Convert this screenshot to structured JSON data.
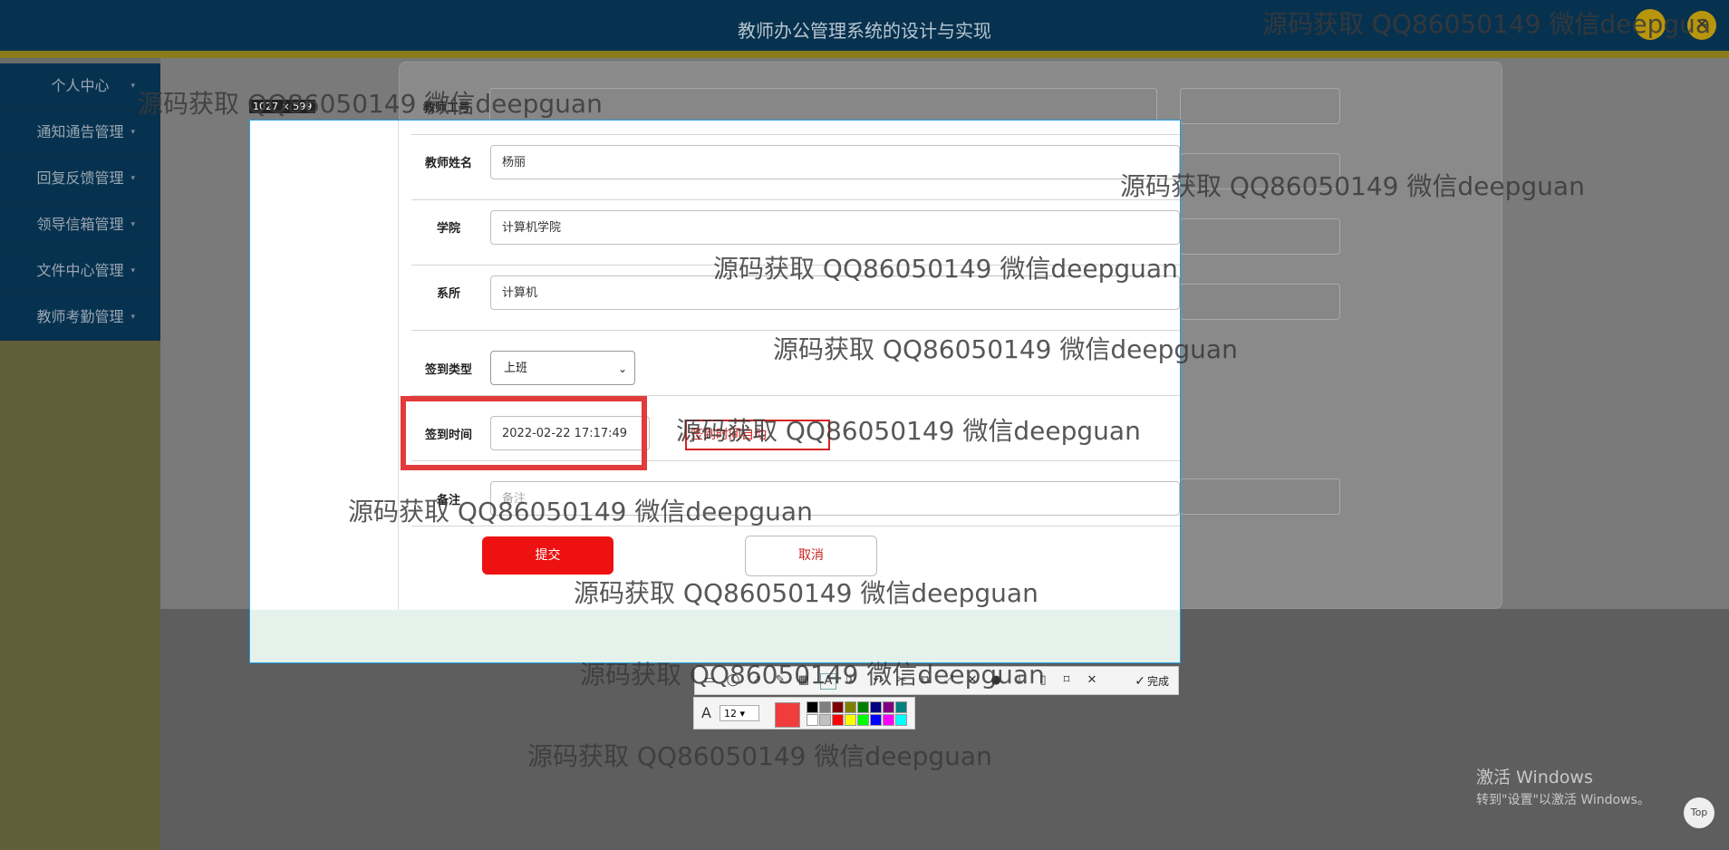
{
  "header": {
    "title": "教师办公管理系统的设计与实现",
    "exit_icon": "close-icon"
  },
  "sidebar": {
    "items": [
      {
        "label": "个人中心"
      },
      {
        "label": "通知通告管理"
      },
      {
        "label": "回复反馈管理"
      },
      {
        "label": "领导信箱管理"
      },
      {
        "label": "文件中心管理"
      },
      {
        "label": "教师考勤管理"
      }
    ]
  },
  "form": {
    "teacher_id_label": "教师工号",
    "teacher_name_label": "教师姓名",
    "teacher_name_value": "杨丽",
    "college_label": "学院",
    "college_value": "计算机学院",
    "department_label": "系所",
    "department_value": "计算机",
    "checkin_type_label": "签到类型",
    "checkin_type_value": "上班",
    "checkin_time_label": "签到时间",
    "checkin_time_value": "2022-02-22 17:17:49",
    "remark_label": "备注",
    "remark_placeholder": "备注",
    "submit_label": "提交",
    "cancel_label": "取消"
  },
  "screenshot_tool": {
    "size_label": "1027 × 599",
    "annotation_text": "签到时间自动",
    "done_label": "完成",
    "font_size": "12",
    "current_color": "#f03c3c",
    "palette": [
      "#000000",
      "#808080",
      "#800000",
      "#808000",
      "#008000",
      "#000080",
      "#800080",
      "#008080",
      "#ffffff",
      "#c0c0c0",
      "#ff0000",
      "#ffff00",
      "#00ff00",
      "#0000ff",
      "#ff00ff",
      "#00ffff"
    ]
  },
  "watermark": "源码获取 QQ86050149 微信deepguan",
  "watermark_partial": "源码获取 QQ86050149 微信deepgua",
  "os_notice": {
    "line1": "激活 Windows",
    "line2": "转到\"设置\"以激活 Windows。"
  },
  "top_button": "Top"
}
